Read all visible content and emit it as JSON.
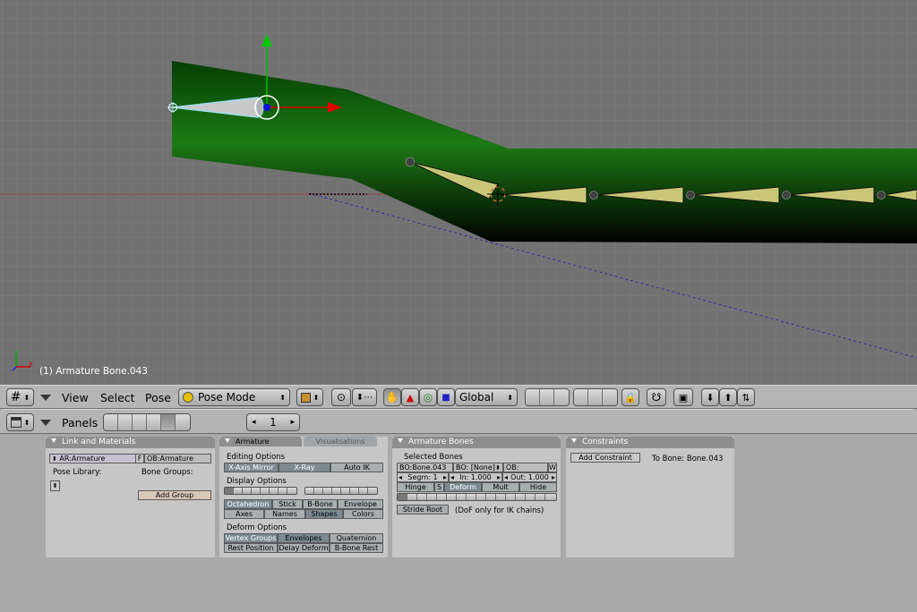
{
  "viewport": {
    "status": "(1) Armature Bone.043"
  },
  "header": {
    "menus": [
      "View",
      "Select",
      "Pose"
    ],
    "mode": "Pose Mode",
    "orientation": "Global"
  },
  "buttons_header": {
    "panels_label": "Panels",
    "frame": "1"
  },
  "link_materials": {
    "title": "Link and Materials",
    "armature_field": "AR:Armature",
    "f_label": "F",
    "ob_field": "OB:Armature",
    "pose_library": "Pose Library:",
    "bone_groups": "Bone Groups:",
    "add_group": "Add Group"
  },
  "armature": {
    "tab_active": "Armature",
    "tab_other": "Visualisations",
    "editing_options": "Editing Options",
    "editing_buttons": [
      "X-Axis Mirror",
      "X-Ray",
      "Auto IK"
    ],
    "display_options": "Display Options",
    "display_row1": [
      "Octahedron",
      "Stick",
      "B-Bone",
      "Envelope"
    ],
    "display_row2": [
      "Axes",
      "Names",
      "Shapes",
      "Colors"
    ],
    "deform_options": "Deform Options",
    "deform_row1": [
      "Vertex Groups",
      "Envelopes",
      "Quaternion"
    ],
    "deform_row2": [
      "Rest Position",
      "Delay Deform",
      "B-Bone Rest"
    ]
  },
  "armature_bones": {
    "title": "Armature Bones",
    "selected_bones": "Selected Bones",
    "bone_name": "BO:Bone.043",
    "parent": "BO: [None]",
    "ob": "OB:",
    "w": "W",
    "segm": "Segm: 1",
    "in": "In: 1.000",
    "out": "Out: 1.000",
    "hinge": "Hinge",
    "s": "S",
    "deform": "Deform",
    "mult": "Mult",
    "hide": "Hide",
    "stride_root": "Stride Root",
    "dof_note": "(DoF only for IK chains)"
  },
  "constraints": {
    "title": "Constraints",
    "add_constraint": "Add Constraint",
    "to_bone": "To Bone: Bone.043"
  }
}
